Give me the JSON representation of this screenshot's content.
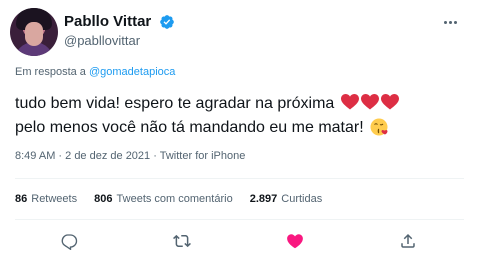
{
  "user": {
    "display_name": "Pabllo Vittar",
    "handle": "@pabllovittar",
    "verified": true
  },
  "reply": {
    "prefix": "Em resposta a",
    "mention": "@gomadetapioca"
  },
  "tweet": {
    "line1": "tudo bem vida! espero te agradar na próxima",
    "line2": "pelo menos você não tá mandando eu me matar!",
    "emojis": [
      "red-heart",
      "red-heart",
      "red-heart",
      "face-blowing-kiss"
    ]
  },
  "meta": {
    "time": "8:49 AM",
    "separator": " · ",
    "date": "2 de dez de 2021",
    "source": "Twitter for iPhone"
  },
  "stats": {
    "retweets_count": "86",
    "retweets_label": "Retweets",
    "quotes_count": "806",
    "quotes_label": "Tweets com comentário",
    "likes_count": "2.897",
    "likes_label": "Curtidas"
  },
  "actions": [
    "reply-icon",
    "retweet-icon",
    "like-icon",
    "share-icon"
  ],
  "colors": {
    "accent": "#1d9bf0",
    "like": "#f91880",
    "text": "#0f1419",
    "secondary": "#536471",
    "heart_emoji": "#dd2e44"
  }
}
